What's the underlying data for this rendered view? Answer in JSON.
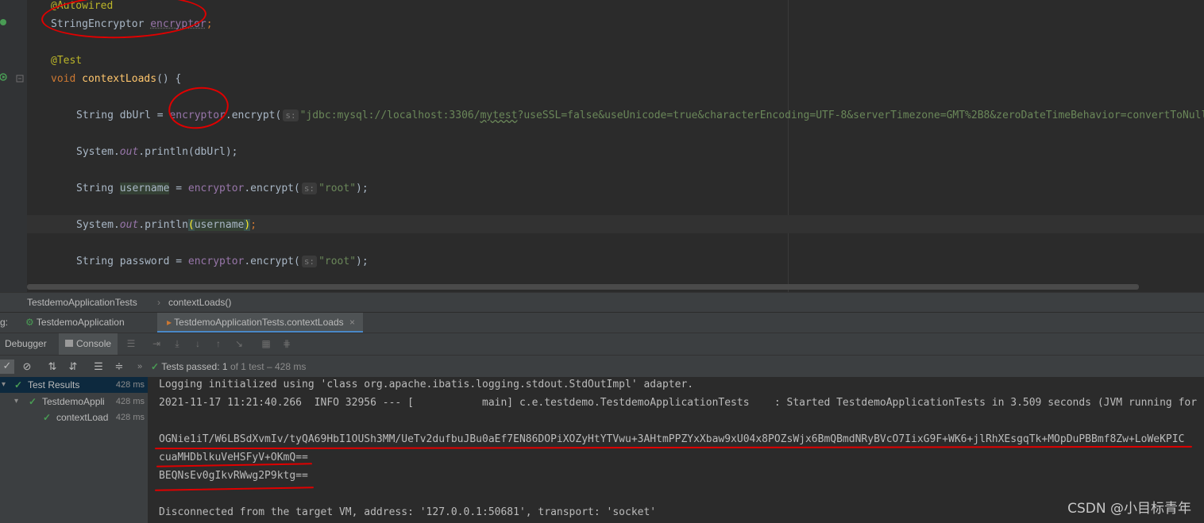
{
  "editor": {
    "lines": {
      "l1_annotation": "@Autowired",
      "l2_type": "StringEncryptor",
      "l2_var": "encryptor",
      "l2_end": ";",
      "l4_annotation": "@Test",
      "l5_kw": "void",
      "l5_fn": "contextLoads",
      "l5_end": "() {",
      "l6_type": "String",
      "l6_var": "dbUrl",
      "l6_eq": " = ",
      "l6_field": "encryptor",
      "l6_call": ".encrypt(",
      "l6_hint": "s:",
      "l6_str": "\"jdbc:mysql://localhost:3306/",
      "l6_str_typo": "mytest",
      "l6_str_rest": "?useSSL=false&useUnicode=true&characterEncoding=UTF-8&serverTimezone=GMT%2B8&zeroDateTimeBehavior=convertToNull\"",
      "l7_a": "System.",
      "l7_out": "out",
      "l7_b": ".println(dbUrl);",
      "l8_type": "String",
      "l8_var": "username",
      "l8_eq": " = ",
      "l8_field": "encryptor",
      "l8_call": ".encrypt(",
      "l8_hint": "s:",
      "l8_str": "\"root\"",
      "l8_end": ");",
      "l9_a": "System.",
      "l9_out": "out",
      "l9_b": ".println",
      "l9_paren1": "(",
      "l9_arg": "username",
      "l9_paren2": ")",
      "l9_end": ";",
      "l10_type": "String",
      "l10_var": "password",
      "l10_eq": " = ",
      "l10_field": "encryptor",
      "l10_call": ".encrypt(",
      "l10_hint": "s:",
      "l10_str": "\"root\"",
      "l10_end": ");"
    }
  },
  "breadcrumb": {
    "class": "TestdemoApplicationTests",
    "sep": "›",
    "method": "contextLoads()"
  },
  "run_tabs": {
    "prefix": "g:",
    "tab1": "TestdemoApplication",
    "tab2": "TestdemoApplicationTests.contextLoads",
    "close": "×"
  },
  "toolbar": {
    "debugger": "Debugger",
    "console": "Console"
  },
  "test_status": {
    "label": "Tests passed:",
    "passed": "1",
    "rest": "of 1 test – 428 ms"
  },
  "tree": {
    "root": {
      "label": "Test Results",
      "time": "428 ms"
    },
    "child": {
      "label": "TestdemoAppli",
      "time": "428 ms"
    },
    "leaf": {
      "label": "contextLoad",
      "time": "428 ms"
    }
  },
  "console": {
    "line1": "Logging initialized using 'class org.apache.ibatis.logging.stdout.StdOutImpl' adapter.",
    "line2": "2021-11-17 11:21:40.266  INFO 32956 --- [           main] c.e.testdemo.TestdemoApplicationTests    : Started TestdemoApplicationTests in 3.509 seconds (JVM running for",
    "line3": "OGNie1iT/W6LBSdXvmIv/tyQA69HbI1OUSh3MM/UeTv2dufbuJBu0aEf7EN86DOPiXOZyHtYTVwu+3AHtmPPZYxXbaw9xU04x8POZsWjx6BmQBmdNRyBVcO7IixG9F+WK6+jlRhXEsgqTk+MOpDuPBBmf8Zw+LoWeKPIC",
    "line4": "cuaMHDblkuVeHSFyV+OKmQ==",
    "line5": "BEQNsEv0gIkvRWwg2P9ktg==",
    "line6": "Disconnected from the target VM, address: '127.0.0.1:50681', transport: 'socket'"
  },
  "watermark": "CSDN @小目标青年",
  "colors": {
    "annotation_mark": "#e00000",
    "pass_green": "#499c54"
  }
}
